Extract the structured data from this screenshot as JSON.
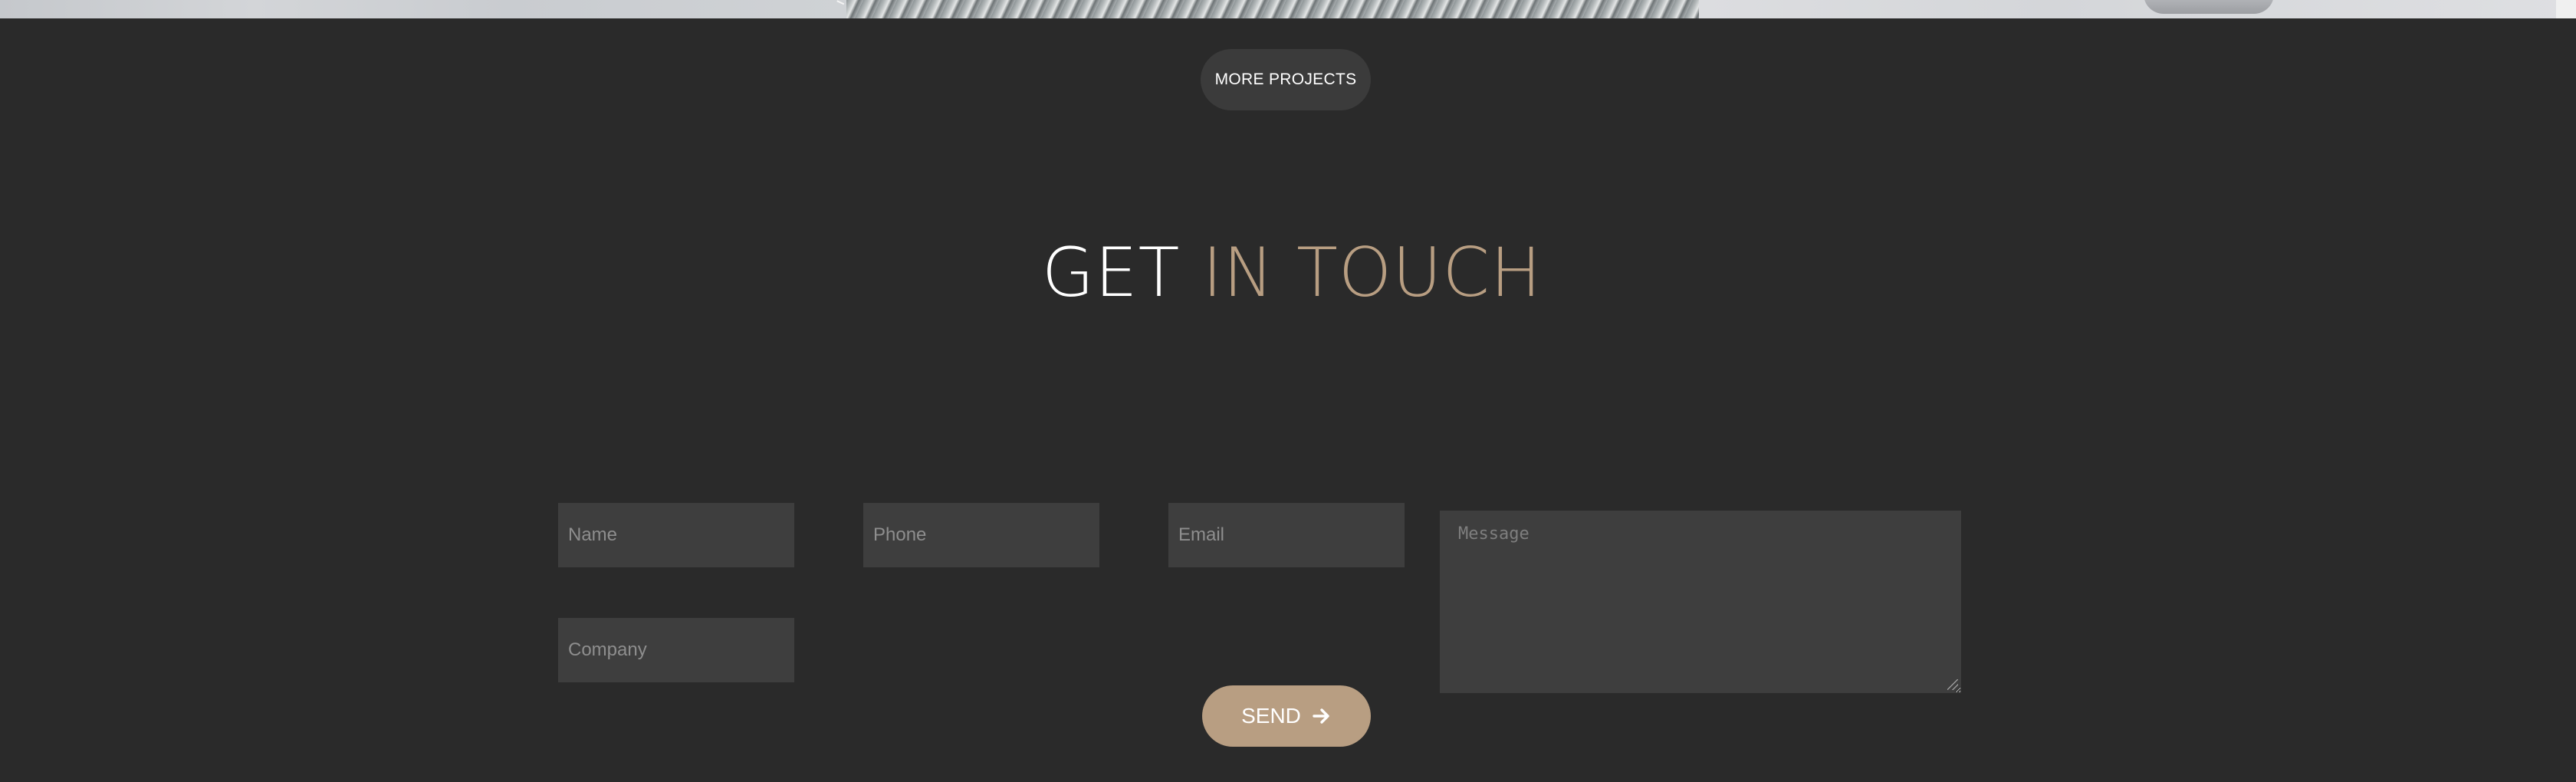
{
  "projects": {
    "more_label": "MORE PROJECTS"
  },
  "contact": {
    "title_part1": "GET",
    "title_part2": "IN TOUCH",
    "accent_color": "#b89e82",
    "fields": {
      "name_placeholder": "Name",
      "phone_placeholder": "Phone",
      "email_placeholder": "Email",
      "company_placeholder": "Company",
      "message_placeholder": "Message"
    },
    "send_label": "SEND",
    "send_icon": "arrow-right-icon"
  }
}
